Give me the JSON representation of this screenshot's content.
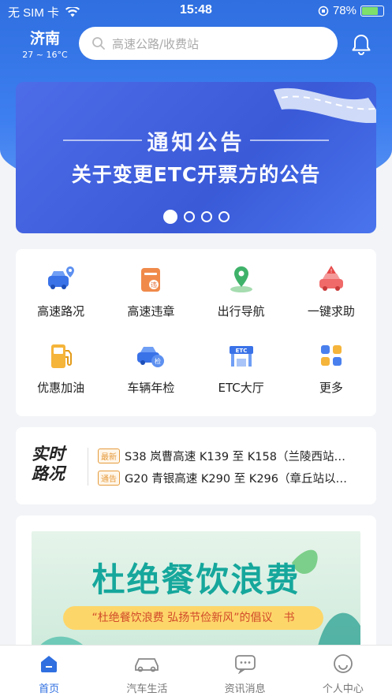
{
  "status": {
    "carrier": "无 SIM 卡",
    "time": "15:48",
    "battery": "78%",
    "battery_level": 0.78
  },
  "header": {
    "city": "济南",
    "temp": "27 ~ 16°C",
    "search_placeholder": "高速公路/收费站"
  },
  "banner": {
    "title": "通知公告",
    "subtitle": "关于变更ETC开票方的公告",
    "pages": 4,
    "active_page": 0
  },
  "services": [
    {
      "label": "高速路况",
      "icon": "car-location-icon"
    },
    {
      "label": "高速违章",
      "icon": "violation-ticket-icon"
    },
    {
      "label": "出行导航",
      "icon": "navigation-pin-icon"
    },
    {
      "label": "一键求助",
      "icon": "emergency-car-icon"
    },
    {
      "label": "优惠加油",
      "icon": "fuel-pump-icon"
    },
    {
      "label": "车辆年检",
      "icon": "car-inspection-icon"
    },
    {
      "label": "ETC大厅",
      "icon": "etc-toll-icon"
    },
    {
      "label": "更多",
      "icon": "more-grid-icon"
    }
  ],
  "traffic": {
    "label_line1": "实时",
    "label_line2": "路况",
    "items": [
      {
        "tag": "最新",
        "text": "S38 岚曹高速 K139 至 K158（兰陵西站…"
      },
      {
        "tag": "通告",
        "text": "G20 青银高速 K290 至 K296（章丘站以…"
      }
    ]
  },
  "promo": {
    "title": "杜绝餐饮浪费",
    "slogan": "“杜绝餐饮浪费 弘扬节俭新风”的倡议　书"
  },
  "tabs": [
    {
      "label": "首页",
      "icon": "home-icon",
      "active": true
    },
    {
      "label": "汽车生活",
      "icon": "car-icon",
      "active": false
    },
    {
      "label": "资讯消息",
      "icon": "message-icon",
      "active": false
    },
    {
      "label": "个人中心",
      "icon": "smiley-user-icon",
      "active": false
    }
  ],
  "colors": {
    "primary": "#2f6fe0",
    "tag": "#e59b3c",
    "promo_title": "#16a79c"
  }
}
